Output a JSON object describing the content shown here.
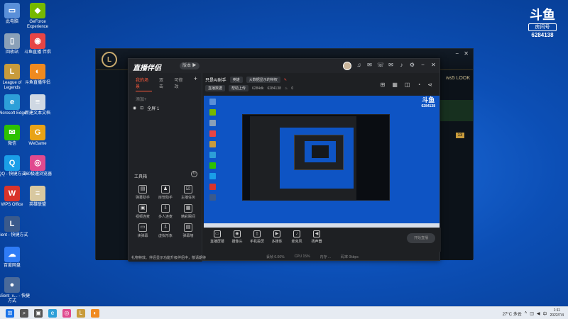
{
  "desktop_icons": [
    {
      "name": "此电脑",
      "glyph": "▭",
      "color": "#5a8fd8"
    },
    {
      "name": "GeForce Experience",
      "glyph": "◆",
      "color": "#76b900"
    },
    {
      "name": "回收站",
      "glyph": "▯",
      "color": "#8aa0b8"
    },
    {
      "name": "斗鱼直播 伴侣",
      "glyph": "◉",
      "color": "#e64545"
    },
    {
      "name": "League of Legends",
      "glyph": "L",
      "color": "#c89b3c"
    },
    {
      "name": "斗鱼直播伴侣",
      "glyph": "◐",
      "color": "#f08a20"
    },
    {
      "name": "Microsoft Edge",
      "glyph": "e",
      "color": "#2d9fd8"
    },
    {
      "name": "新建文本文档",
      "glyph": "≡",
      "color": "#cfd8e3"
    },
    {
      "name": "微信",
      "glyph": "✉",
      "color": "#2dc100"
    },
    {
      "name": "WeGame",
      "glyph": "G",
      "color": "#e8a317"
    },
    {
      "name": "QQ - 快捷方式",
      "glyph": "Q",
      "color": "#1a9ee8"
    },
    {
      "name": "360极速浏览器",
      "glyph": "◎",
      "color": "#e04a8f"
    },
    {
      "name": "WPS Office",
      "glyph": "W",
      "color": "#d9342b"
    },
    {
      "name": "英雄联盟",
      "glyph": "≡",
      "color": "#d8c8a0"
    },
    {
      "name": "Client - 快捷方式",
      "glyph": "L",
      "color": "#3a5a8c"
    },
    {
      "name": "百度网盘",
      "glyph": "☁",
      "color": "#2f7cf6"
    },
    {
      "name": "tclsSent_x... - 快捷方式",
      "glyph": "●",
      "color": "#4a6a9a"
    }
  ],
  "watermark": {
    "logo": "斗鱼",
    "room_label": "房间号",
    "room_id": "6284138"
  },
  "game_window": {
    "logo_glyph": "L",
    "header_text": "ws5 LOOK",
    "ctrl_minimize": "−",
    "ctrl_close": "✕",
    "badge": "13"
  },
  "app": {
    "logo_text": "直播伴侣",
    "version_label": "版本 ▶",
    "left_tabs": [
      "我的场景",
      "双击",
      "可修改"
    ],
    "scene_add_label": "添加+",
    "scene_name": "全屏 1",
    "toolbox_title": "工具箱",
    "tools": [
      {
        "label": "弹幕助手",
        "glyph": "▤"
      },
      {
        "label": "房管助手",
        "glyph": "♟"
      },
      {
        "label": "主播任务",
        "glyph": "☑"
      },
      {
        "label": "视频连麦",
        "glyph": "▣"
      },
      {
        "label": "多人连麦",
        "glyph": "⇩"
      },
      {
        "label": "精彩瞬间",
        "glyph": "▦"
      },
      {
        "label": "读弹幕",
        "glyph": "▭"
      },
      {
        "label": "虚拟形象",
        "glyph": "⇩"
      },
      {
        "label": "弹幕墙",
        "glyph": "▤"
      }
    ],
    "gift_notice": "礼物特效、伴侣显示功能升级伴侣中，敬请期待",
    "stream_title": "只是AI射手",
    "category_chip": "英雄",
    "notice_text": "大数据显示的特权",
    "stream_chips": [
      "直播数据",
      "帮助上传"
    ],
    "viewer_count": "6284dk",
    "room_id": "6284138",
    "hot_value": "0",
    "control_items": [
      {
        "label": "直播屏幕",
        "glyph": "▭"
      },
      {
        "label": "摄像头",
        "glyph": "◉"
      },
      {
        "label": "手机投屏",
        "glyph": "▯"
      },
      {
        "label": "多媒体",
        "glyph": "▶"
      },
      {
        "label": "麦克风",
        "glyph": "♪"
      },
      {
        "label": "扬声器",
        "glyph": "◀"
      }
    ],
    "start_button": "开始直播",
    "status_items": [
      "丢帧 0.00%",
      "CPU 15%",
      "内存 ...",
      "码率 0kbps"
    ],
    "preview_watermark": "斗鱼",
    "preview_room_id": "6284138"
  },
  "taskbar": {
    "weather": "27°C 多云",
    "ime": "中",
    "time": "1:11",
    "date": "2022/7/4",
    "apps": [
      {
        "glyph": "⊞",
        "color": "#1a73e8"
      },
      {
        "glyph": "⌕",
        "color": "#555"
      },
      {
        "glyph": "▣",
        "color": "#555"
      },
      {
        "glyph": "e",
        "color": "#2d9fd8"
      },
      {
        "glyph": "◎",
        "color": "#e04a8f"
      },
      {
        "glyph": "L",
        "color": "#c89b3c"
      },
      {
        "glyph": "◐",
        "color": "#f08a20"
      }
    ]
  }
}
